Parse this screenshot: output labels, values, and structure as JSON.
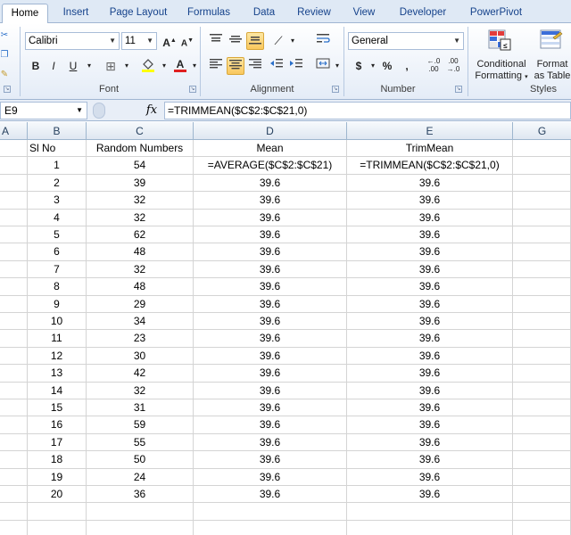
{
  "ribbon": {
    "tabs": [
      "Home",
      "Insert",
      "Page Layout",
      "Formulas",
      "Data",
      "Review",
      "View",
      "Developer",
      "PowerPivot"
    ],
    "active_tab": "Home",
    "font": {
      "name": "Calibri",
      "size": "11",
      "group_label": "Font"
    },
    "alignment": {
      "group_label": "Alignment"
    },
    "number": {
      "format": "General",
      "group_label": "Number",
      "currency": "$",
      "percent": "%",
      "comma": ","
    },
    "styles": {
      "conditional_formatting_line1": "Conditional",
      "conditional_formatting_line2": "Formatting",
      "format_table_line1": "Format",
      "format_table_line2": "as Table",
      "group_label": "Styles"
    }
  },
  "formula_bar": {
    "name_box": "E9",
    "fx": "fx",
    "formula": "=TRIMMEAN($C$2:$C$21,0)"
  },
  "sheet": {
    "column_headers": [
      "A",
      "B",
      "C",
      "D",
      "E",
      "G"
    ],
    "header_row": {
      "sl_no": "Sl No",
      "random": "Random Numbers",
      "mean": "Mean",
      "trimmean": "TrimMean"
    },
    "rows": [
      {
        "sl": "1",
        "num": "54",
        "mean": "=AVERAGE($C$2:$C$21)",
        "trim": "=TRIMMEAN($C$2:$C$21,0)"
      },
      {
        "sl": "2",
        "num": "39",
        "mean": "39.6",
        "trim": "39.6"
      },
      {
        "sl": "3",
        "num": "32",
        "mean": "39.6",
        "trim": "39.6"
      },
      {
        "sl": "4",
        "num": "32",
        "mean": "39.6",
        "trim": "39.6"
      },
      {
        "sl": "5",
        "num": "62",
        "mean": "39.6",
        "trim": "39.6"
      },
      {
        "sl": "6",
        "num": "48",
        "mean": "39.6",
        "trim": "39.6"
      },
      {
        "sl": "7",
        "num": "32",
        "mean": "39.6",
        "trim": "39.6"
      },
      {
        "sl": "8",
        "num": "48",
        "mean": "39.6",
        "trim": "39.6"
      },
      {
        "sl": "9",
        "num": "29",
        "mean": "39.6",
        "trim": "39.6"
      },
      {
        "sl": "10",
        "num": "34",
        "mean": "39.6",
        "trim": "39.6"
      },
      {
        "sl": "11",
        "num": "23",
        "mean": "39.6",
        "trim": "39.6"
      },
      {
        "sl": "12",
        "num": "30",
        "mean": "39.6",
        "trim": "39.6"
      },
      {
        "sl": "13",
        "num": "42",
        "mean": "39.6",
        "trim": "39.6"
      },
      {
        "sl": "14",
        "num": "32",
        "mean": "39.6",
        "trim": "39.6"
      },
      {
        "sl": "15",
        "num": "31",
        "mean": "39.6",
        "trim": "39.6"
      },
      {
        "sl": "16",
        "num": "59",
        "mean": "39.6",
        "trim": "39.6"
      },
      {
        "sl": "17",
        "num": "55",
        "mean": "39.6",
        "trim": "39.6"
      },
      {
        "sl": "18",
        "num": "50",
        "mean": "39.6",
        "trim": "39.6"
      },
      {
        "sl": "19",
        "num": "24",
        "mean": "39.6",
        "trim": "39.6"
      },
      {
        "sl": "20",
        "num": "36",
        "mean": "39.6",
        "trim": "39.6"
      }
    ]
  },
  "colors": {
    "ribbon_tab_text": "#15428b",
    "grid_line": "#d4d4d4",
    "header_text": "#27415f",
    "selected_button": "#f9c75d"
  }
}
